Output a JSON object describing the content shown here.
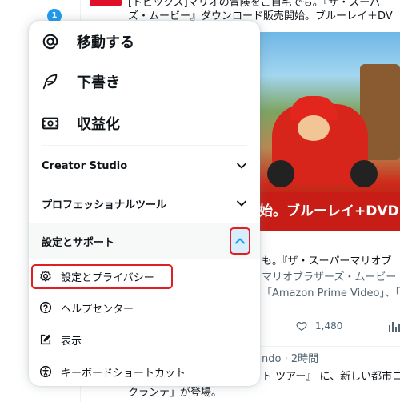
{
  "background": {
    "notification_count": "1",
    "tweet1_line1": "[トピックス]マリオの冒険をご自宅でも。『ザ・スーパ",
    "tweet1_line2": "ズ・ムービー』ダウンロード販売開始。ブルーレイ＋DV",
    "image_banner": "始。ブルーレイ+DVD",
    "tweet2_line1": "も。『ザ・スーパーマリオブ",
    "tweet2_line2": "マリオブラザーズ・ムービー",
    "tweet2_line3": "「Amazon Prime Video」、「",
    "like_count": "1,480",
    "tweet3_meta": "ndo · 2時間",
    "tweet3_line1": "ト ツアー』 に、新しい都市コ",
    "tweet3_line2": "クランテ」が登場。"
  },
  "menu": {
    "main_items": [
      {
        "icon": "at-sign-icon",
        "label": "移動する"
      },
      {
        "icon": "feather-icon",
        "label": "下書き"
      },
      {
        "icon": "money-icon",
        "label": "収益化"
      }
    ],
    "sections": [
      {
        "label": "Creator Studio",
        "state": "collapsed"
      },
      {
        "label": "プロフェッショナルツール",
        "state": "collapsed"
      },
      {
        "label": "設定とサポート",
        "state": "expanded"
      }
    ],
    "sub_items": [
      {
        "icon": "gear-icon",
        "label": "設定とプライバシー"
      },
      {
        "icon": "help-circle-icon",
        "label": "ヘルプセンター"
      },
      {
        "icon": "edit-icon",
        "label": "表示"
      },
      {
        "icon": "accessibility-icon",
        "label": "キーボードショートカット"
      }
    ]
  },
  "colors": {
    "accent": "#1d9bf0",
    "highlight_red": "#e02020",
    "text": "#0f1419",
    "muted": "#536471"
  }
}
